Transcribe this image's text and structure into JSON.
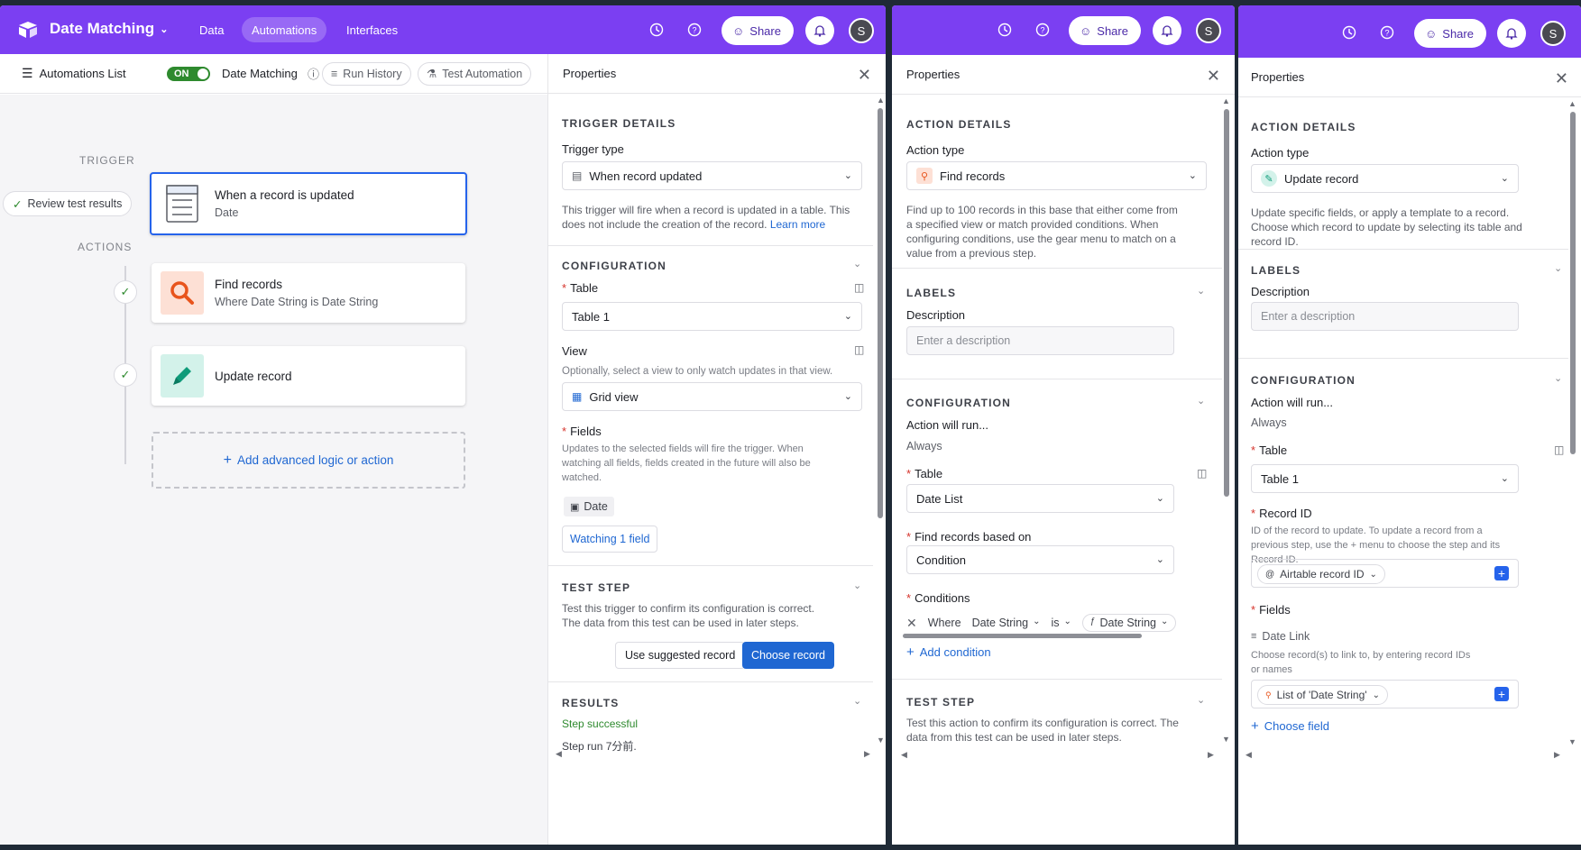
{
  "app": {
    "base_name": "Date Matching",
    "nav_tabs": [
      "Data",
      "Automations",
      "Interfaces"
    ],
    "share_label": "Share",
    "avatar_initial": "S"
  },
  "subbar": {
    "automations_list": "Automations List",
    "toggle": "ON",
    "automation_name": "Date Matching",
    "run_history": "Run History",
    "test_automation": "Test Automation"
  },
  "flow": {
    "trigger_label": "TRIGGER",
    "actions_label": "ACTIONS",
    "review_btn": "Review test results",
    "trigger_card": {
      "title": "When a record is updated",
      "subtitle": "Date"
    },
    "action1": {
      "title": "Find records",
      "subtitle": "Where Date String is Date String"
    },
    "action2": {
      "title": "Update record"
    },
    "add_logic": "Add advanced logic or action"
  },
  "panel1": {
    "title": "Properties",
    "trigger_details": "TRIGGER DETAILS",
    "trigger_type_label": "Trigger type",
    "trigger_type_value": "When record updated",
    "trigger_help": "This trigger will fire when a record is updated in a table. This does not include the creation of the record.",
    "learn_more": "Learn more",
    "configuration": "CONFIGURATION",
    "table_label": "Table",
    "table_value": "Table 1",
    "view_label": "View",
    "view_help": "Optionally, select a view to only watch updates in that view.",
    "view_value": "Grid view",
    "fields_label": "Fields",
    "fields_help": "Updates to the selected fields will fire the trigger. When watching all fields, fields created in the future will also be watched.",
    "field_chip": "Date",
    "watching": "Watching 1 field",
    "test_step": "TEST STEP",
    "test_help": "Test this trigger to confirm its configuration is correct. The data from this test can be used in later steps.",
    "use_suggested": "Use suggested record",
    "choose_record": "Choose record",
    "results": "RESULTS",
    "step_success": "Step successful",
    "step_run": "Step run 7分前."
  },
  "panel2": {
    "title": "Properties",
    "action_details": "ACTION DETAILS",
    "action_type_label": "Action type",
    "action_type_value": "Find records",
    "action_help": "Find up to 100 records in this base that either come from a specified view or match provided conditions. When configuring conditions, use the gear menu to match on a value from a previous step.",
    "labels": "LABELS",
    "description_label": "Description",
    "description_placeholder": "Enter a description",
    "configuration": "CONFIGURATION",
    "will_run_label": "Action will run...",
    "will_run_value": "Always",
    "table_label": "Table",
    "table_value": "Date List",
    "find_based_label": "Find records based on",
    "find_based_value": "Condition",
    "conditions_label": "Conditions",
    "cond_where": "Where",
    "cond_field": "Date String",
    "cond_op": "is",
    "cond_value": "Date String",
    "add_condition": "Add condition",
    "test_step": "TEST STEP",
    "test_help": "Test this action to confirm its configuration is correct. The data from this test can be used in later steps."
  },
  "panel3": {
    "title": "Properties",
    "action_details": "ACTION DETAILS",
    "action_type_label": "Action type",
    "action_type_value": "Update record",
    "action_help": "Update specific fields, or apply a template to a record. Choose which record to update by selecting its table and record ID.",
    "labels": "LABELS",
    "description_label": "Description",
    "description_placeholder": "Enter a description",
    "configuration": "CONFIGURATION",
    "will_run_label": "Action will run...",
    "will_run_value": "Always",
    "table_label": "Table",
    "table_value": "Table 1",
    "record_id_label": "Record ID",
    "record_id_help": "ID of the record to update. To update a record from a previous step, use the + menu to choose the step and its Record ID.",
    "record_id_token": "Airtable record ID",
    "fields_label": "Fields",
    "field_name": "Date Link",
    "field_help": "Choose record(s) to link to, by entering record IDs or names",
    "field_token": "List of 'Date String'",
    "choose_field": "Choose field"
  },
  "colors": {
    "brand": "#7b3ff2",
    "primary_button": "#1f67d2",
    "success": "#2e8a2e"
  }
}
